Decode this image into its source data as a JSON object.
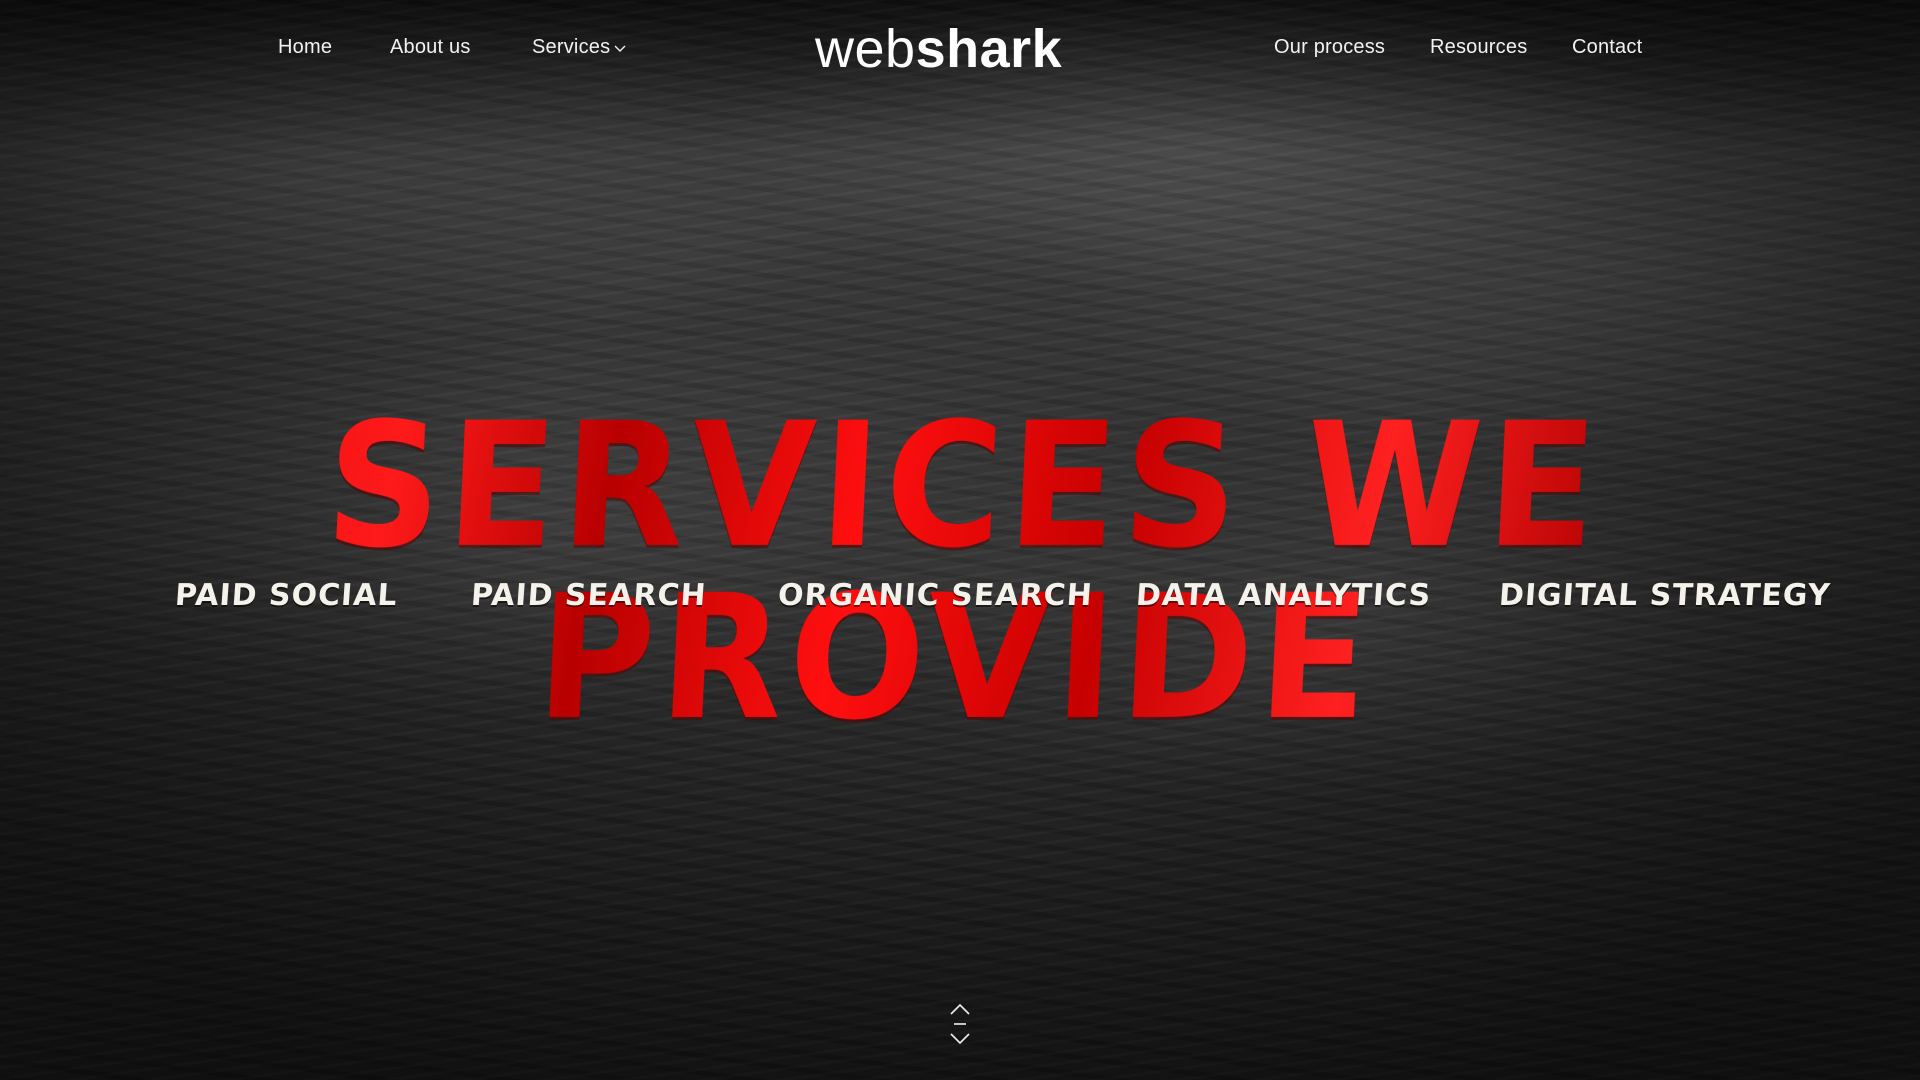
{
  "nav": {
    "left": [
      {
        "label": "Home"
      },
      {
        "label": "About us"
      },
      {
        "label": "Services",
        "icon": "chevron-down-icon"
      }
    ],
    "logo": {
      "light": "web",
      "bold": "shark"
    },
    "right": [
      {
        "label": "Our process"
      },
      {
        "label": "Resources"
      },
      {
        "label": "Contact"
      }
    ]
  },
  "hero": {
    "title": "SERVICES WE PROVIDE",
    "title_color": "#e60000"
  },
  "services": [
    {
      "label": "PAID SOCIAL"
    },
    {
      "label": "PAID SEARCH"
    },
    {
      "label": "ORGANIC SEARCH"
    },
    {
      "label": "DATA ANALYTICS"
    },
    {
      "label": "DIGITAL STRATEGY"
    }
  ],
  "scroll_control": {
    "up_icon": "chevron-up-icon",
    "down_icon": "chevron-down-icon"
  },
  "colors": {
    "background": "#1c1c1c",
    "text": "#ffffff",
    "accent": "#e60000"
  }
}
